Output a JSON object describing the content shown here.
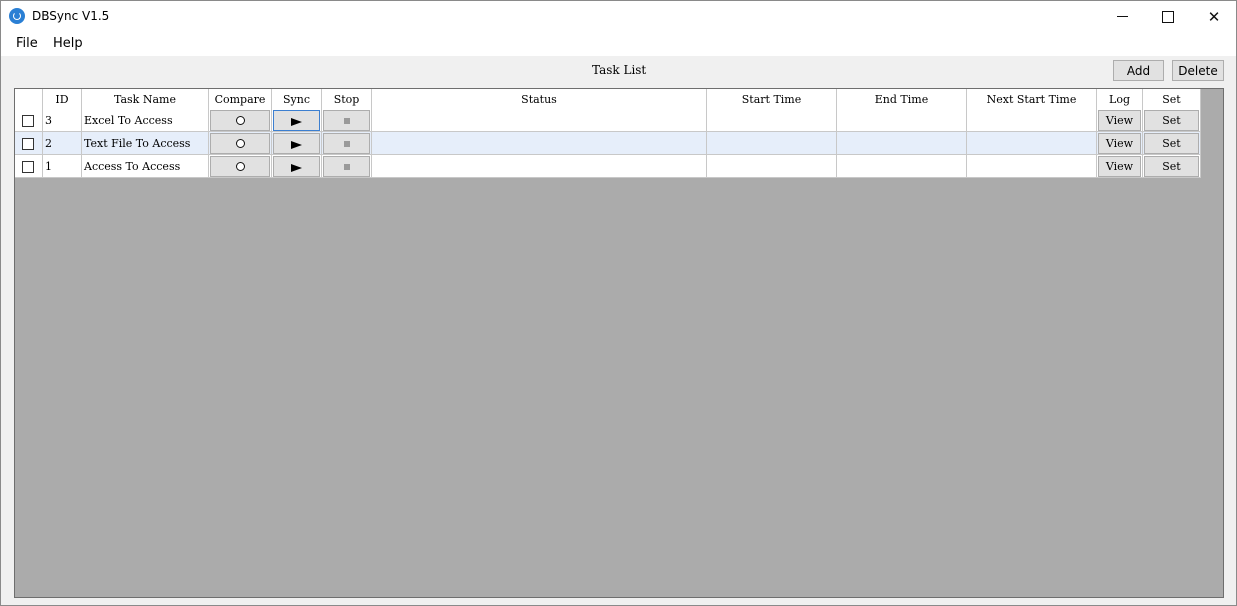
{
  "window": {
    "title": "DBSync V1.5"
  },
  "menu": {
    "items": [
      "File",
      "Help"
    ]
  },
  "toolbar": {
    "title": "Task List",
    "add_label": "Add",
    "delete_label": "Delete"
  },
  "grid": {
    "columns": [
      "",
      "ID",
      "Task Name",
      "Compare",
      "Sync",
      "Stop",
      "Status",
      "Start Time",
      "End Time",
      "Next Start Time",
      "Log",
      "Set"
    ],
    "rows": [
      {
        "id": "3",
        "task_name": "Excel To Access",
        "status": "",
        "start_time": "",
        "end_time": "",
        "next_start_time": "",
        "log_label": "View",
        "set_label": "Set"
      },
      {
        "id": "2",
        "task_name": "Text File To Access",
        "status": "",
        "start_time": "",
        "end_time": "",
        "next_start_time": "",
        "log_label": "View",
        "set_label": "Set"
      },
      {
        "id": "1",
        "task_name": "Access To Access",
        "status": "",
        "start_time": "",
        "end_time": "",
        "next_start_time": "",
        "log_label": "View",
        "set_label": "Set"
      }
    ]
  },
  "icons": {
    "app": "dbsync-app-icon",
    "compare": "circle-icon",
    "sync": "play-icon",
    "stop": "stop-icon"
  },
  "colors": {
    "accent": "#2a7fd4",
    "selected_row": "#e6eefa",
    "grid_background": "#ababab"
  }
}
